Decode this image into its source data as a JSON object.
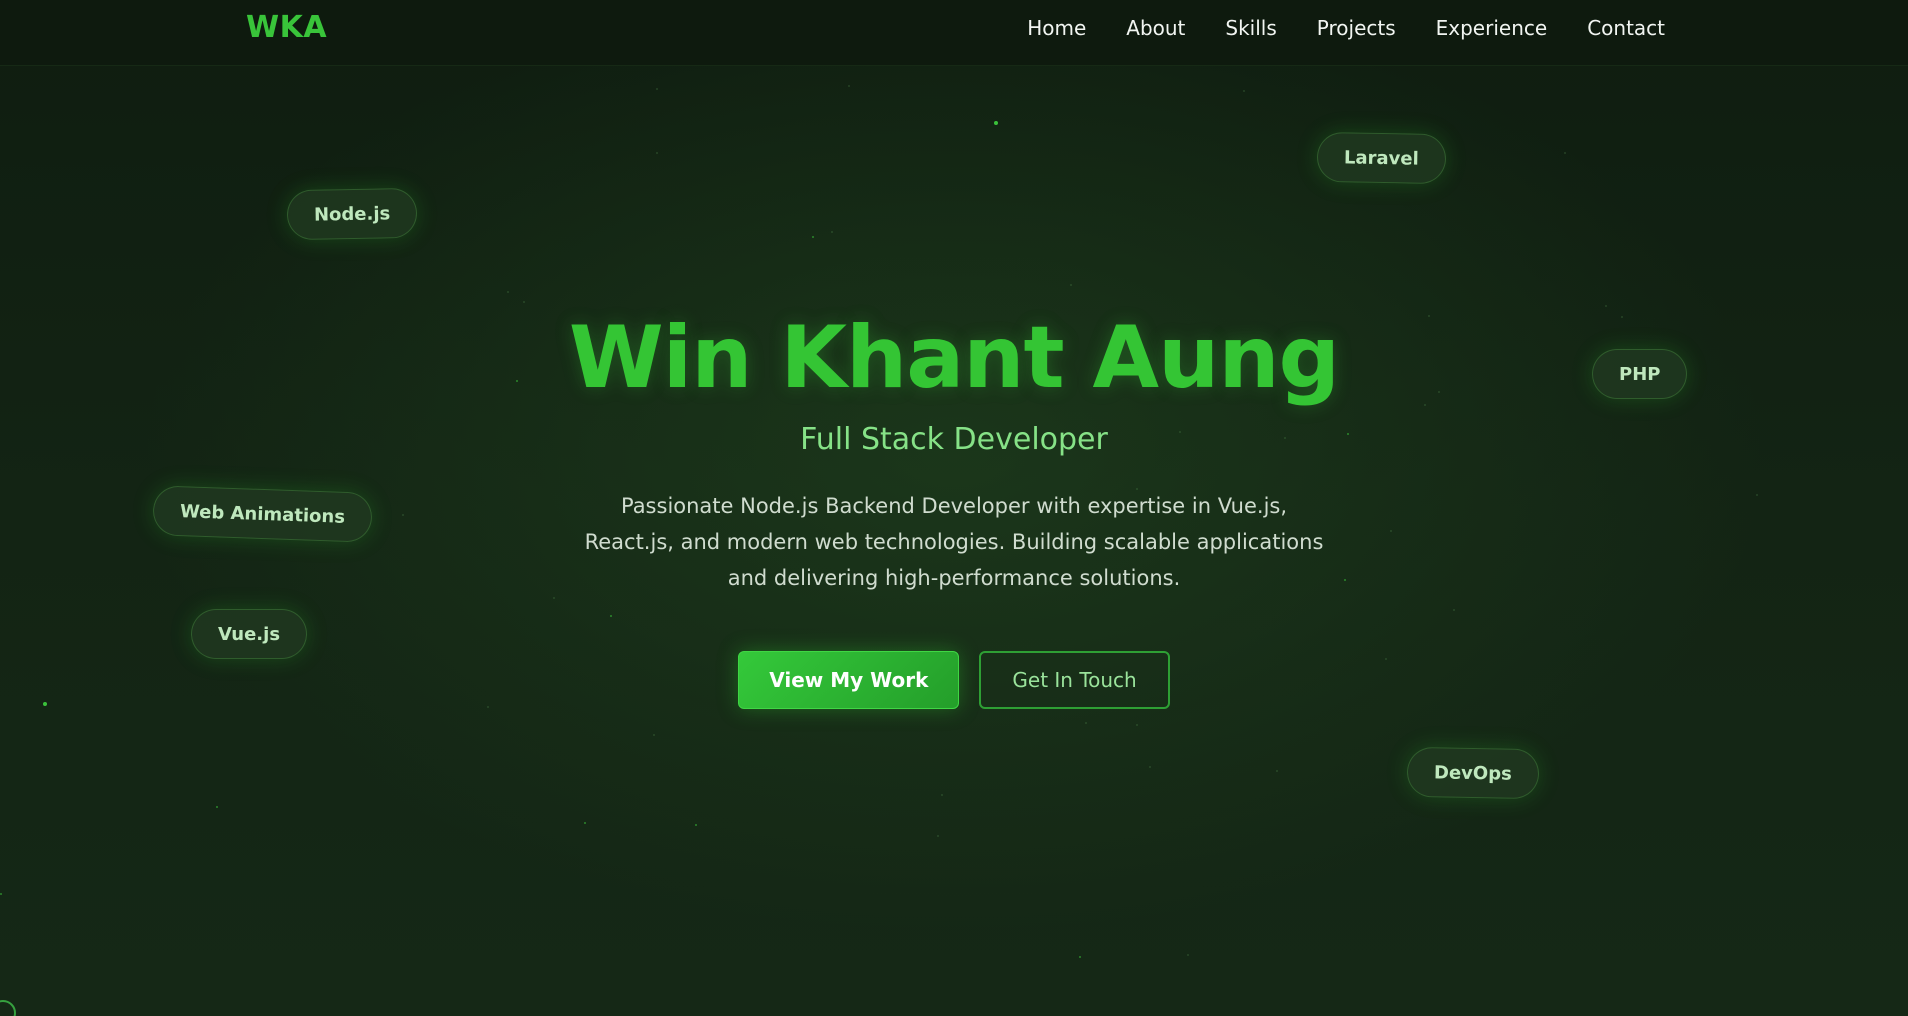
{
  "logo": "WKA",
  "nav": {
    "items": [
      {
        "label": "Home"
      },
      {
        "label": "About"
      },
      {
        "label": "Skills"
      },
      {
        "label": "Projects"
      },
      {
        "label": "Experience"
      },
      {
        "label": "Contact"
      }
    ]
  },
  "floating_tags": {
    "nodejs": "Node.js",
    "laravel": "Laravel",
    "php": "PHP",
    "web_animations": "Web Animations",
    "vuejs": "Vue.js",
    "devops": "DevOps"
  },
  "hero": {
    "name": "Win Khant Aung",
    "role": "Full Stack Developer",
    "description": "Passionate Node.js Backend Developer with expertise in Vue.js, React.js, and modern web technologies. Building scalable applications and delivering high-performance solutions.",
    "primary_button": "View My Work",
    "secondary_button": "Get In Touch"
  },
  "colors": {
    "accent": "#34c534",
    "background": "#132414",
    "role_text": "#86e287",
    "nav_text": "#f1f5f1"
  }
}
